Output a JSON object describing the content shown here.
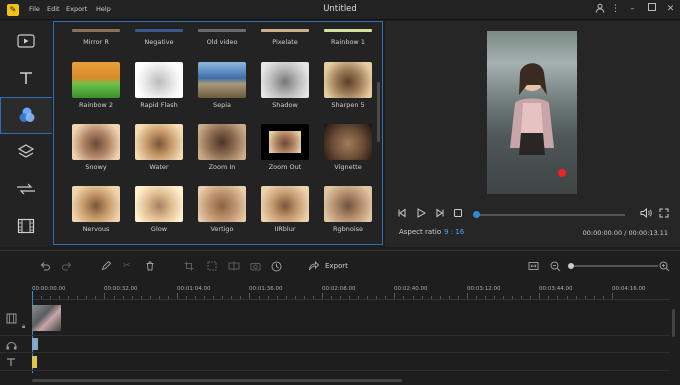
{
  "app": {
    "title": "Untitled",
    "menu": [
      "File",
      "Edit",
      "Export",
      "Help"
    ]
  },
  "sidebar": {
    "items": [
      "media-icon",
      "text-icon",
      "filters-icon",
      "overlays-icon",
      "transitions-icon",
      "elements-icon"
    ],
    "active": "filters-icon"
  },
  "filters": {
    "top_row": [
      "Mirror R",
      "Negative",
      "Old video",
      "Pixelate",
      "Rainbow 1"
    ],
    "rows": [
      [
        "Rainbow 2",
        "Rapid Flash",
        "Sepia",
        "Shadow",
        "Sharpen 5"
      ],
      [
        "Snowy",
        "Water",
        "Zoom In",
        "Zoom Out",
        "Vignette"
      ],
      [
        "Nervous",
        "Glow",
        "Vertigo",
        "IIRblur",
        "Rgbnoise"
      ]
    ]
  },
  "preview": {
    "aspect_label": "Aspect ratio",
    "aspect_value": "9 : 16",
    "time": "00:00:00.00 / 00:00:13.11",
    "progress": 0.0
  },
  "timeline": {
    "export_label": "Export",
    "ruler": [
      "00:00:00.00",
      "00:00:32.00",
      "00:01:04.00",
      "00:01:36.00",
      "00:02:08.00",
      "00:02:40.00",
      "00:03:12.00",
      "00:03:44.00",
      "00:04:16.00"
    ]
  },
  "colors": {
    "accent": "#2f6fb5",
    "knob": "#2f8bd8",
    "aspect_value": "#4aa3ff",
    "logo": "#f2c21a"
  }
}
